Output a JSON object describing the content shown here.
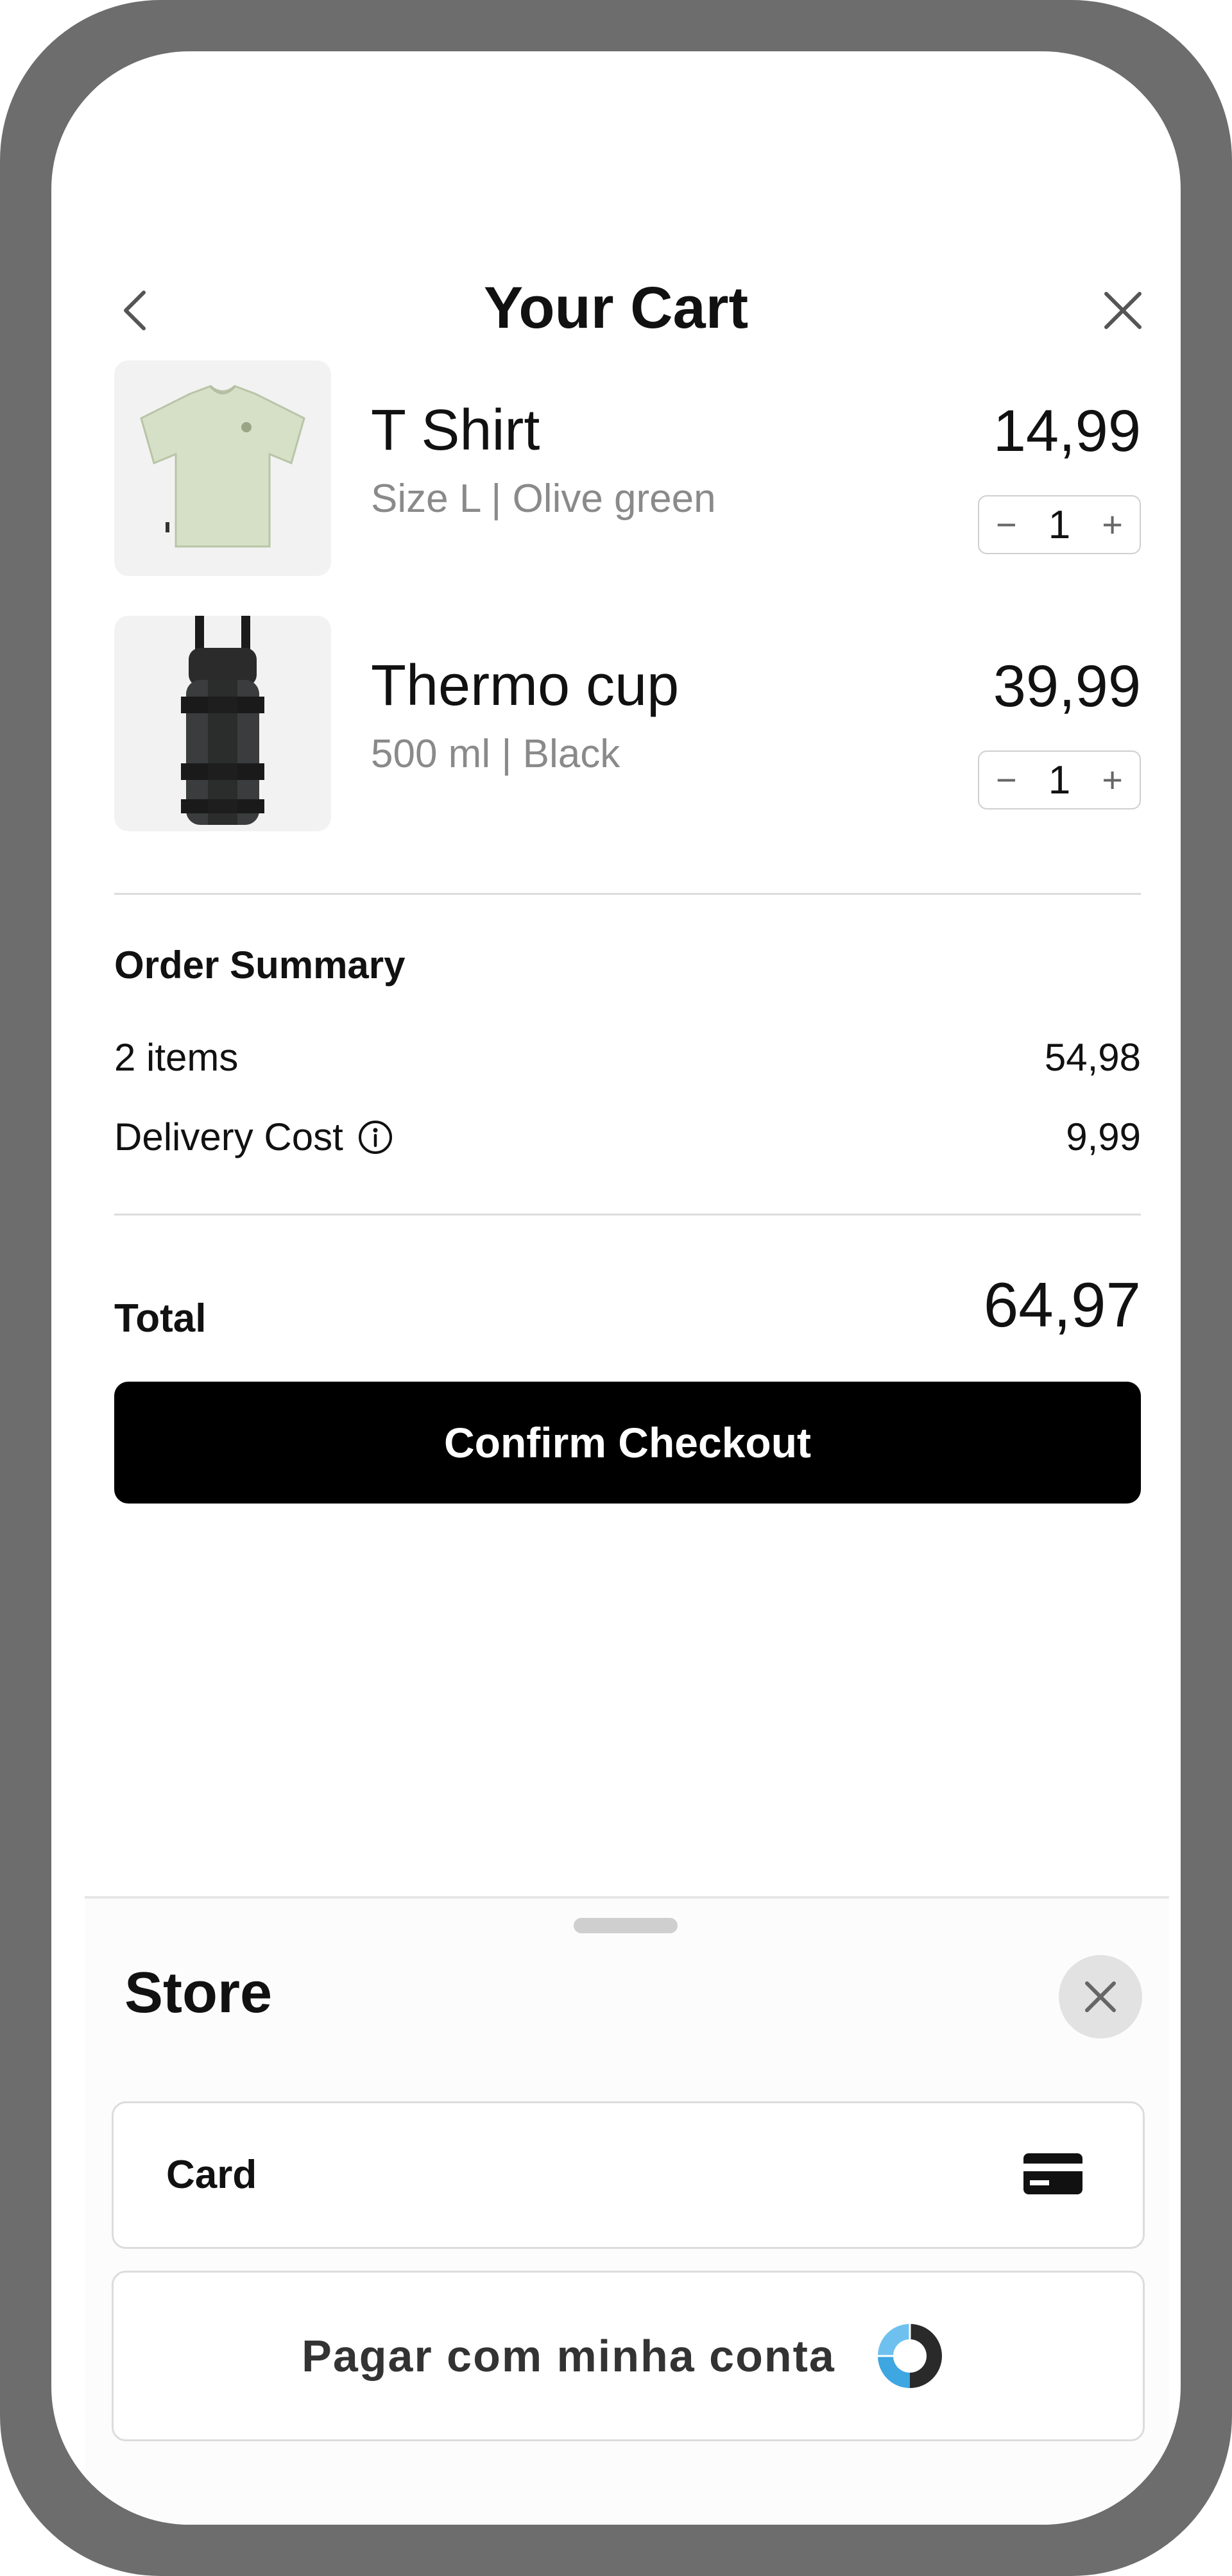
{
  "header": {
    "title": "Your Cart"
  },
  "items": [
    {
      "name": "T Shirt",
      "variant": "Size L | Olive green",
      "price": "14,99",
      "quantity": "1",
      "image": "t-shirt"
    },
    {
      "name": "Thermo cup",
      "variant": "500 ml | Black",
      "price": "39,99",
      "quantity": "1",
      "image": "thermo-cup"
    }
  ],
  "stepper": {
    "minus": "−",
    "plus": "+"
  },
  "summary": {
    "title": "Order Summary",
    "items_label": "2 items",
    "items_value": "54,98",
    "delivery_label": "Delivery Cost",
    "delivery_value": "9,99",
    "total_label": "Total",
    "total_value": "64,97"
  },
  "checkout": {
    "label": "Confirm Checkout"
  },
  "sheet": {
    "title": "Store",
    "card_label": "Card",
    "account_label": "Pagar com minha conta"
  },
  "colors": {
    "accent": "#000000",
    "logo_blue": "#3ea6e0",
    "logo_dark": "#2a2a2a",
    "muted_text": "#8a8a8a"
  },
  "icons": [
    "chevron-left-icon",
    "close-icon",
    "info-icon",
    "credit-card-icon",
    "account-logo-icon"
  ]
}
